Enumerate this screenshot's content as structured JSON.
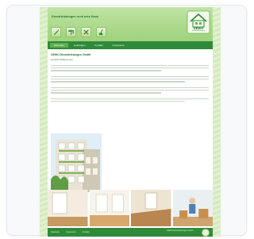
{
  "site": {
    "title": "Dienstleistungen rund ums Haus",
    "logo_text": "GEWO",
    "logo_sub": "Dienstleistungen",
    "header_icons": [
      "brush-icon",
      "roller-icon",
      "tools-icon",
      "broom-icon"
    ],
    "nav": [
      {
        "label": "Startseite",
        "active": true
      },
      {
        "label": "Leistungen",
        "active": false
      },
      {
        "label": "Kontakt",
        "active": false
      },
      {
        "label": "Impressum",
        "active": false
      }
    ],
    "content": {
      "title": "GEWO Dienstleistungen GmbH",
      "subtitle": "Herzlich Willkommen"
    },
    "footer": {
      "links": [
        "Startseite",
        "Impressum",
        "Kontakt"
      ],
      "right_text": "GEWO Dienstleistungen GmbH"
    }
  },
  "colors": {
    "primary": "#2f8a3a",
    "header_light": "#bfe3a4",
    "accent": "#5fae4e",
    "background_stripes": "#d7ecc2"
  }
}
